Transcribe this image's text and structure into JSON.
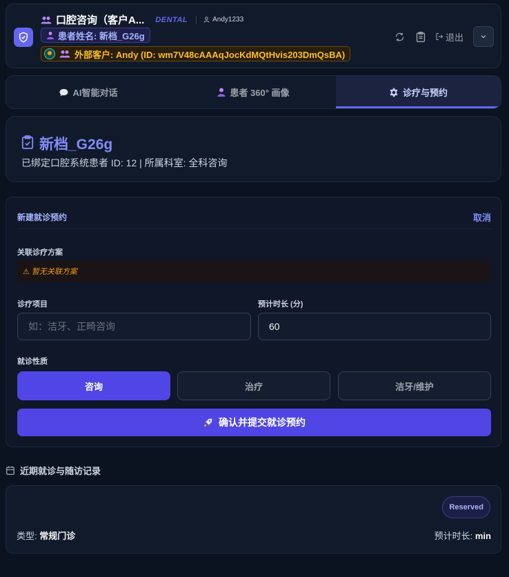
{
  "header": {
    "title": "口腔咨询（客户A...",
    "tag": "DENTAL",
    "username": "Andy1233",
    "patient_pill": "患者姓名: 新档_G26g",
    "external_pill": "外部客户: Andy (ID: wm7V48cAAAqJocKdMQtHvis203DmQsBA)",
    "logout_label": "退出",
    "icons": [
      "shield-icon",
      "group-icon",
      "user-icon",
      "refresh-icon",
      "clipboard-icon",
      "logout-icon",
      "chevron-down-icon"
    ]
  },
  "tabs": [
    {
      "label": "AI智能对话",
      "icon": "chat-icon",
      "active": false
    },
    {
      "label": "患者 360° 画像",
      "icon": "person-icon",
      "active": false
    },
    {
      "label": "诊疗与预约",
      "icon": "gear-icon",
      "active": true
    }
  ],
  "patient": {
    "name": "新档_G26g",
    "subtitle": "已绑定口腔系统患者 ID: 12 | 所属科室: 全科咨询"
  },
  "form": {
    "title": "新建就诊预约",
    "cancel_label": "取消",
    "plan_label": "关联诊疗方案",
    "plan_warning": "⚠ 暂无关联方案",
    "item_label": "诊疗项目",
    "item_placeholder": "如：洁牙、正畸咨询",
    "duration_label": "预计时长 (分)",
    "duration_value": "60",
    "nature_label": "就诊性质",
    "options": [
      "咨询",
      "治疗",
      "洁牙/维护"
    ],
    "selected_option": "咨询",
    "submit_label": "确认并提交就诊预约"
  },
  "history": {
    "heading": "近期就诊与随访记录",
    "records": [
      {
        "status": "Reserved",
        "type_label": "类型:",
        "type_value": "常规门诊",
        "duration_label": "预计时长:",
        "duration_value": "min"
      }
    ]
  },
  "colors": {
    "accent": "#6366f1",
    "primary_button": "#4f46e5",
    "warning": "#f59e0b",
    "background": "#0b1220"
  }
}
